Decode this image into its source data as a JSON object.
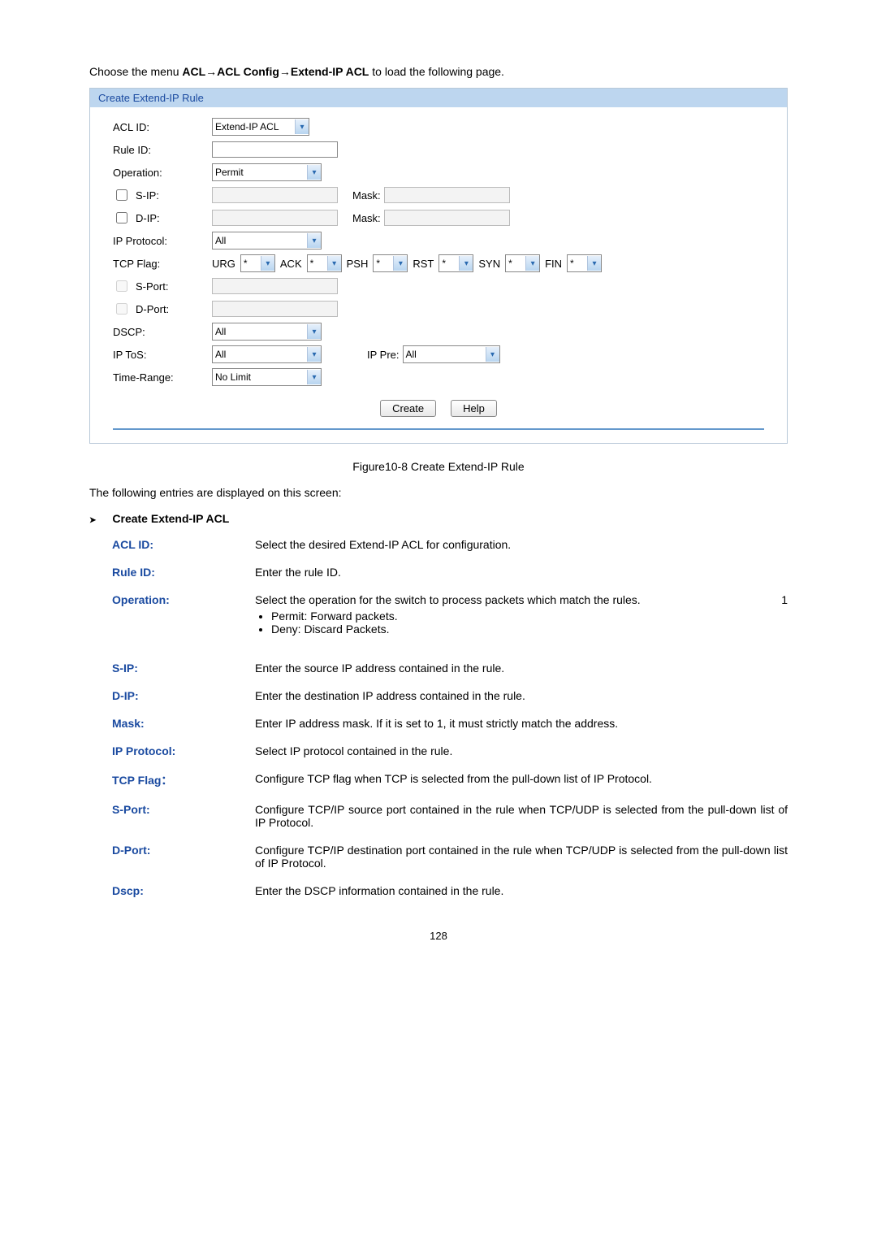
{
  "intro": {
    "prefix": "Choose the menu ",
    "path": "ACL→ACL Config→Extend-IP ACL",
    "suffix": " to load the following page."
  },
  "form": {
    "header": "Create Extend-IP Rule",
    "aclId": {
      "label": "ACL ID:",
      "value": "Extend-IP ACL"
    },
    "ruleId": {
      "label": "Rule ID:",
      "value": ""
    },
    "operation": {
      "label": "Operation:",
      "value": "Permit"
    },
    "sip": {
      "label": "S-IP:",
      "value": "",
      "maskLabel": "Mask:",
      "maskValue": ""
    },
    "dip": {
      "label": "D-IP:",
      "value": "",
      "maskLabel": "Mask:",
      "maskValue": ""
    },
    "ipProtocol": {
      "label": "IP Protocol:",
      "value": "All"
    },
    "tcpFlag": {
      "label": "TCP Flag:",
      "flags": [
        {
          "name": "URG",
          "val": "*"
        },
        {
          "name": "ACK",
          "val": "*"
        },
        {
          "name": "PSH",
          "val": "*"
        },
        {
          "name": "RST",
          "val": "*"
        },
        {
          "name": "SYN",
          "val": "*"
        },
        {
          "name": "FIN",
          "val": "*"
        }
      ]
    },
    "sport": {
      "label": "S-Port:",
      "value": ""
    },
    "dport": {
      "label": "D-Port:",
      "value": ""
    },
    "dscp": {
      "label": "DSCP:",
      "value": "All"
    },
    "iptos": {
      "label": "IP ToS:",
      "value": "All",
      "ipPreLabel": "IP Pre:",
      "ipPreValue": "All"
    },
    "timeRange": {
      "label": "Time-Range:",
      "value": "No Limit"
    },
    "buttons": {
      "create": "Create",
      "help": "Help"
    }
  },
  "figureCaption": "Figure10-8 Create Extend-IP Rule",
  "entriesLine": "The following entries are displayed on this screen:",
  "subhead": "Create Extend-IP ACL",
  "definitions": {
    "aclId": {
      "term": "ACL ID:",
      "desc": "Select the desired Extend-IP ACL for configuration."
    },
    "ruleId": {
      "term": "Rule ID:",
      "desc": "Enter the rule ID."
    },
    "operation": {
      "term": "Operation:",
      "desc": "Select the operation for the switch to process packets which match the rules.",
      "pageN": "1",
      "bullet1": "Permit: Forward packets.",
      "bullet2": "Deny: Discard Packets."
    },
    "sip": {
      "term": "S-IP:",
      "desc": "Enter the source IP address contained in the rule."
    },
    "dip": {
      "term": "D-IP:",
      "desc": "Enter the destination IP address contained in the rule."
    },
    "mask": {
      "term": "Mask:",
      "desc": "Enter IP address mask. If it is set to 1, it must strictly match the address."
    },
    "ipProtocol": {
      "term": "IP Protocol:",
      "desc": "Select IP protocol contained in the rule."
    },
    "tcpFlag": {
      "term": "TCP Flag：",
      "desc": "Configure TCP flag when TCP is selected from the pull-down list of IP Protocol."
    },
    "sport": {
      "term": "S-Port:",
      "desc": "Configure TCP/IP source port contained in the rule when TCP/UDP is selected from the pull-down list of IP Protocol."
    },
    "dport": {
      "term": "D-Port:",
      "desc": "Configure TCP/IP destination port contained in the rule when TCP/UDP is selected from the pull-down list of IP Protocol."
    },
    "dscp": {
      "term": "Dscp:",
      "desc": "Enter the DSCP information contained in the rule."
    }
  },
  "pageNumber": "128"
}
